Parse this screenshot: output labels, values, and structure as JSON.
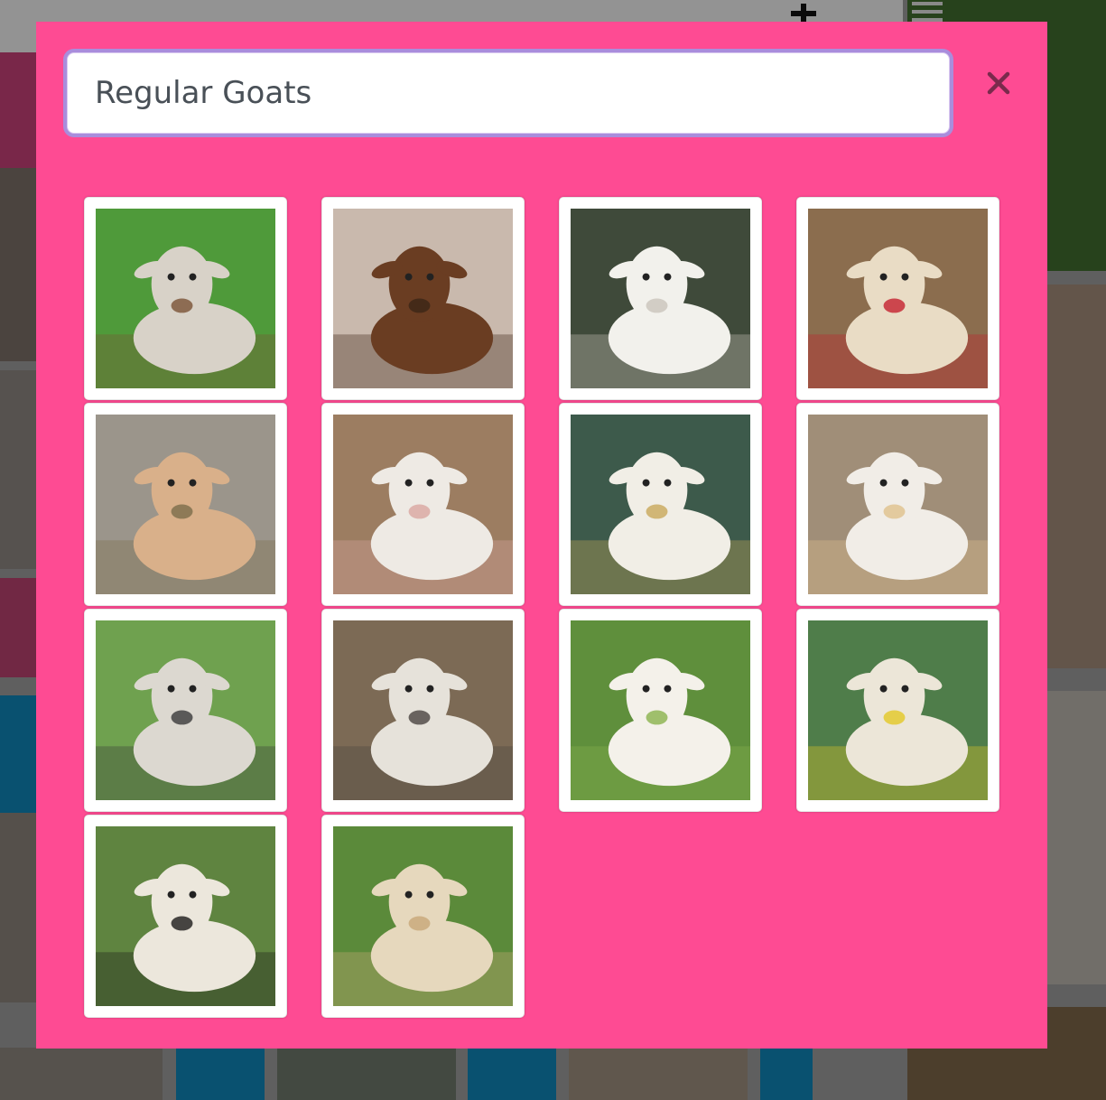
{
  "search": {
    "value": "Regular Goats",
    "placeholder": ""
  },
  "close_icon": "close-icon",
  "colors": {
    "modal_background": "#fe4b93",
    "focus_ring": "#a98ddc"
  },
  "results": [
    {
      "subject": "goat-grinning-horns",
      "bg": "#4f9a3a",
      "body": "#d8d2c8",
      "accent": "#7a5236"
    },
    {
      "subject": "brown-goat-shouting",
      "bg": "#c9b9ad",
      "body": "#6a3d22",
      "accent": "#3b2517"
    },
    {
      "subject": "white-kid-goat-rocks",
      "bg": "#3f4a3a",
      "body": "#f2f1ec",
      "accent": "#c9c4bb"
    },
    {
      "subject": "kid-goat-red-sweater",
      "bg": "#8b6d4e",
      "body": "#e9dcc5",
      "accent": "#c4202e"
    },
    {
      "subject": "baby-goat-hay",
      "bg": "#9b958b",
      "body": "#d9b08a",
      "accent": "#7a6d4a"
    },
    {
      "subject": "smiling-white-goat-closeup",
      "bg": "#9c7d61",
      "body": "#eeeae4",
      "accent": "#d9a6a0"
    },
    {
      "subject": "mountain-goat-forest",
      "bg": "#3d5a4b",
      "body": "#f1eee6",
      "accent": "#c9a85a"
    },
    {
      "subject": "goat-in-jacket-leash",
      "bg": "#a08e78",
      "body": "#f1ede7",
      "accent": "#e0c08c"
    },
    {
      "subject": "goat-in-tub",
      "bg": "#6fa14f",
      "body": "#dcd8d0",
      "accent": "#3a3a3a"
    },
    {
      "subject": "sheep-face-closeup",
      "bg": "#7c6a55",
      "body": "#e6e2da",
      "accent": "#4a4440"
    },
    {
      "subject": "two-lambs-grass",
      "bg": "#5f8f3c",
      "body": "#f4f1ea",
      "accent": "#8ab34c"
    },
    {
      "subject": "sheep-tongue-out",
      "bg": "#4f7d4a",
      "body": "#ece6d8",
      "accent": "#e4c826"
    },
    {
      "subject": "valais-blacknose-sheep",
      "bg": "#5f8440",
      "body": "#ece7dc",
      "accent": "#1d1b1a"
    },
    {
      "subject": "shaggy-sheep-field",
      "bg": "#5b8a3a",
      "body": "#e6d8bd",
      "accent": "#c8a878"
    }
  ]
}
